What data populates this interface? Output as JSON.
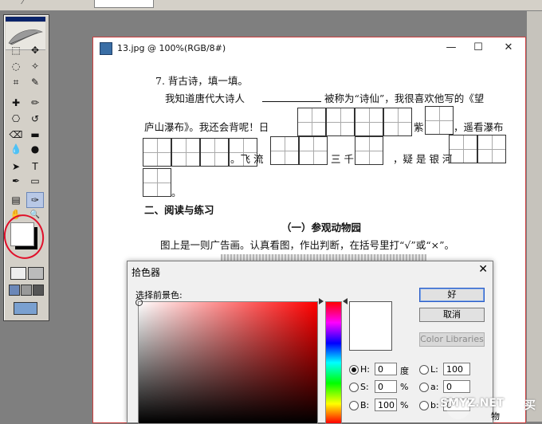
{
  "topbar": {
    "seg1": "",
    "field1": "",
    "seg2": "",
    "field2": ""
  },
  "document": {
    "title": "13.jpg @ 100%(RGB/8#)",
    "win_minimize": "—",
    "win_maximize": "☐",
    "win_close": "✕",
    "lines": {
      "q7": "7. 背古诗，填一填。",
      "l1a": "我知道唐代大诗人",
      "l1b": "被称为“诗仙”，我很喜欢他写的《望",
      "l2a": "庐山瀑布》。我还会背呢！日",
      "l2b": "紫",
      "l2c": "，遥看瀑布",
      "l3a": "。飞 流",
      "l3b": "三 千",
      "l3c": "，疑 是 银 河",
      "l4a": "。",
      "section": "二、阅读与练习",
      "subtitle": "（一）参观动物园",
      "instruction": "图上是一则广告画。认真看图，作出判断，在括号里打“√”或“×”。"
    }
  },
  "picker": {
    "title": "拾色器",
    "close": "✕",
    "label": "选择前景色:",
    "ok": "好",
    "cancel": "取消",
    "libraries": "Color Libraries",
    "fields": {
      "H": {
        "label": "H:",
        "value": "0",
        "unit": "度"
      },
      "S": {
        "label": "S:",
        "value": "0",
        "unit": "%"
      },
      "B": {
        "label": "B:",
        "value": "100",
        "unit": "%"
      },
      "L": {
        "label": "L:",
        "value": "100"
      },
      "a": {
        "label": "a:",
        "value": "0"
      },
      "b": {
        "label": "b:",
        "value": "0"
      }
    },
    "selected_mode": "H"
  },
  "tools": {
    "marquee": "⬚",
    "move": "✥",
    "lasso": "◌",
    "wand": "✧",
    "crop": "⌗",
    "slice": "✎",
    "heal": "✚",
    "brush": "✏",
    "stamp": "⎔",
    "history": "↺",
    "eraser": "⌫",
    "gradient": "▬",
    "blur": "💧",
    "dodge": "●",
    "path": "➤",
    "type": "T",
    "pen": "✒",
    "shape": "▭",
    "notes": "▤",
    "eyedropper": "✑",
    "hand": "✋",
    "zoom": "🔍"
  },
  "watermark": "SMYZ.NET",
  "watermark_extra": "买",
  "partial_text": "物",
  "colors": {
    "accent": "#2a5cc6",
    "annotation": "#e0102a",
    "toolbox": "#d4d0c8"
  }
}
